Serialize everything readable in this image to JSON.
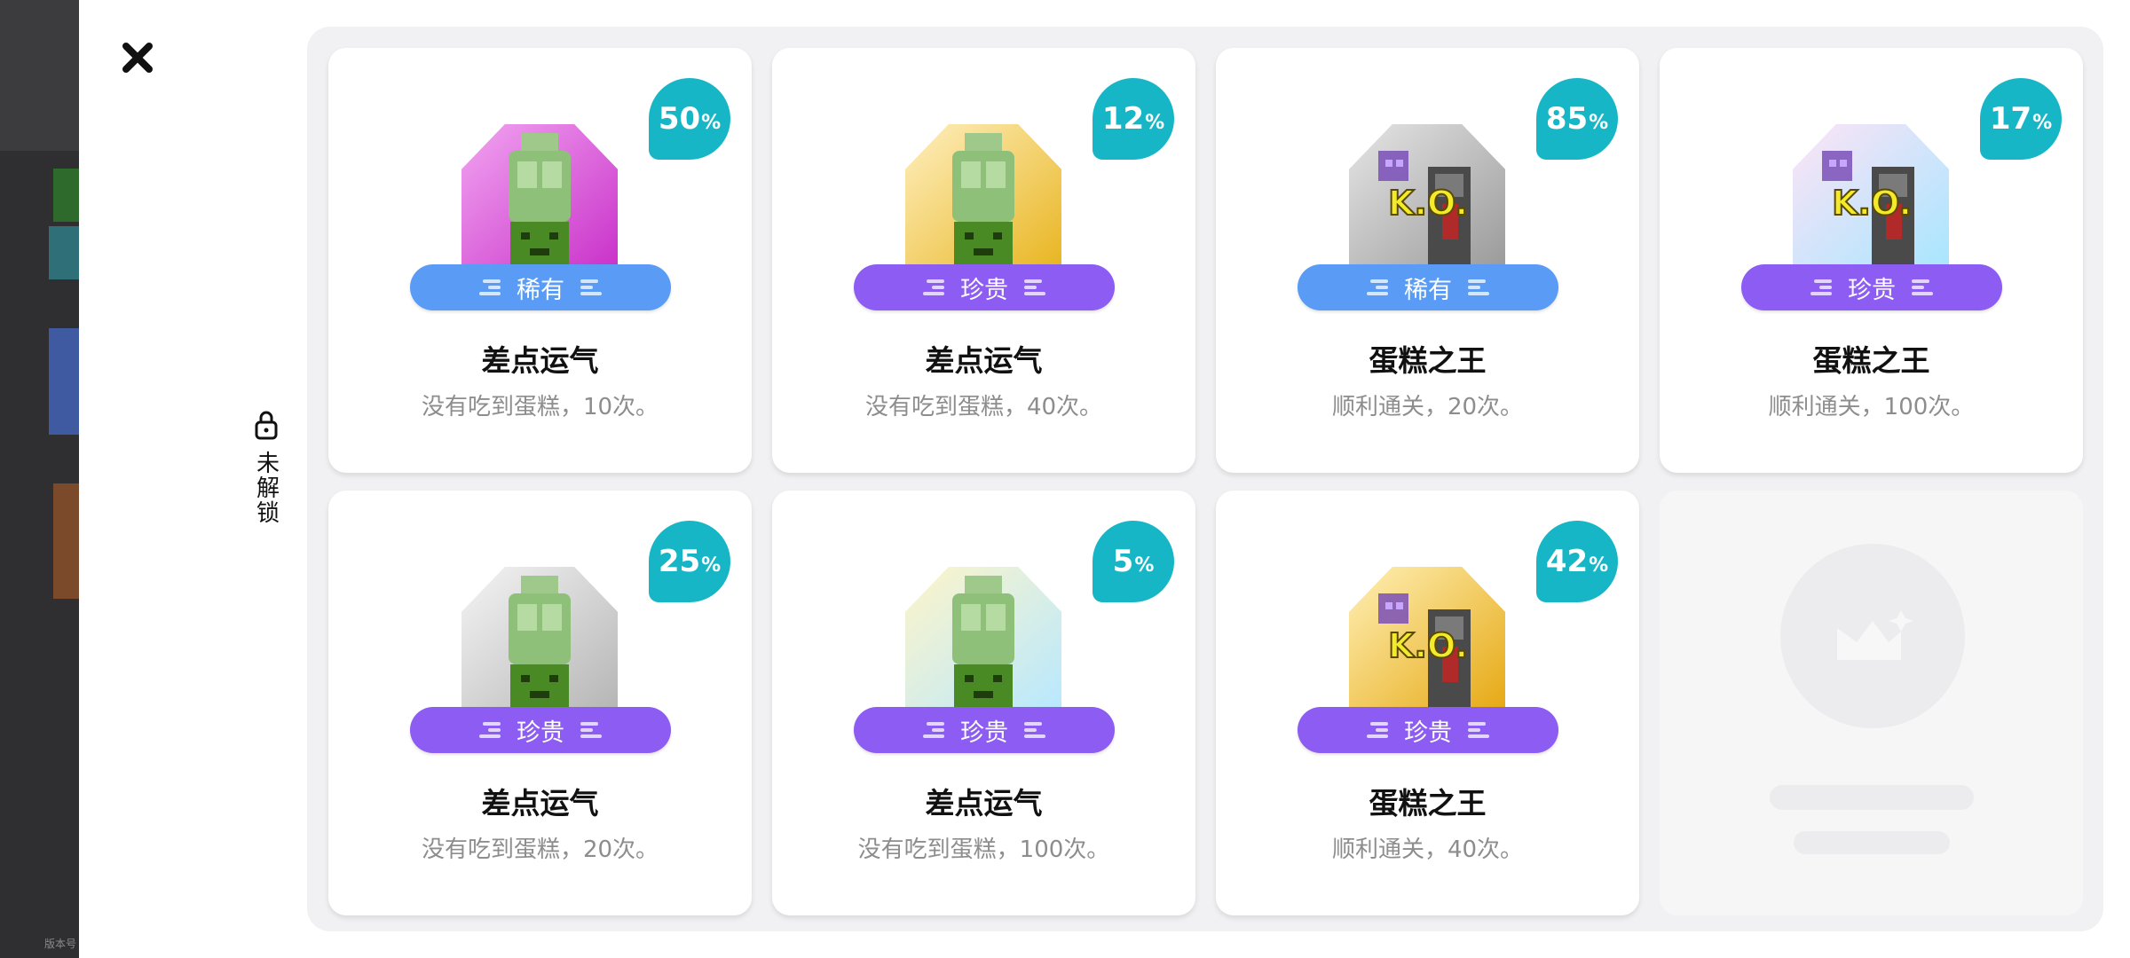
{
  "game": {
    "version_text": "版本号"
  },
  "lock_tab": {
    "label": "未解锁"
  },
  "colors": {
    "pct_bubble": "#17b6c6",
    "rare_blue": "#5a9cf5",
    "precious_purple": "#8d5cf2",
    "panel_bg": "#f1f1f3"
  },
  "cards": [
    {
      "pct": "50",
      "pct_unit": "%",
      "rarity": "稀有",
      "rarity_color": "blue",
      "title": "差点运气",
      "desc": "没有吃到蛋糕，10次。",
      "art": "pink-turtle"
    },
    {
      "pct": "12",
      "pct_unit": "%",
      "rarity": "珍贵",
      "rarity_color": "purple",
      "title": "差点运气",
      "desc": "没有吃到蛋糕，40次。",
      "art": "gold-turtle"
    },
    {
      "pct": "85",
      "pct_unit": "%",
      "rarity": "稀有",
      "rarity_color": "blue",
      "title": "蛋糕之王",
      "desc": "顺利通关，20次。",
      "art": "silver-ko"
    },
    {
      "pct": "17",
      "pct_unit": "%",
      "rarity": "珍贵",
      "rarity_color": "purple",
      "title": "蛋糕之王",
      "desc": "顺利通关，100次。",
      "art": "rainbow-ko"
    },
    {
      "pct": "25",
      "pct_unit": "%",
      "rarity": "珍贵",
      "rarity_color": "purple",
      "title": "差点运气",
      "desc": "没有吃到蛋糕，20次。",
      "art": "silver-turtle"
    },
    {
      "pct": "5",
      "pct_unit": "%",
      "rarity": "珍贵",
      "rarity_color": "purple",
      "title": "差点运气",
      "desc": "没有吃到蛋糕，100次。",
      "art": "rainbow-turtle"
    },
    {
      "pct": "42",
      "pct_unit": "%",
      "rarity": "珍贵",
      "rarity_color": "purple",
      "title": "蛋糕之王",
      "desc": "顺利通关，40次。",
      "art": "gold-ko"
    }
  ],
  "icons": {
    "close": "close-icon",
    "lock": "lock-icon",
    "placeholder": "crown-image-icon"
  }
}
